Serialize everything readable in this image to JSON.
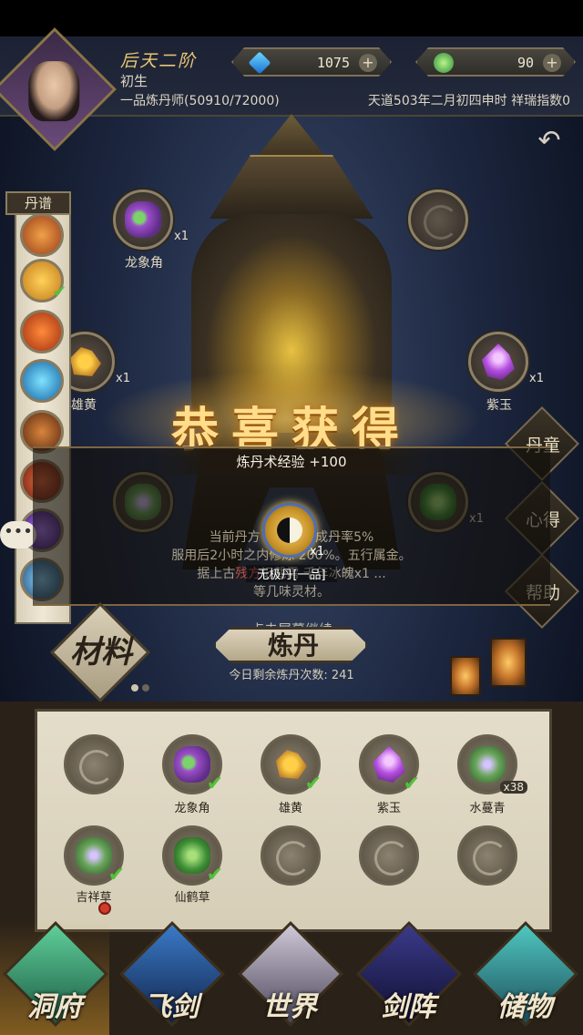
{
  "header": {
    "rank": "后天二阶",
    "stage": "初生",
    "title_line": "一品炼丹师(50910/72000)",
    "currency_1": {
      "icon": "blue-gem-icon",
      "value": "1075"
    },
    "currency_2": {
      "icon": "jade-icon",
      "value": "90"
    },
    "world_time": "天道503年二月初四申时 祥瑞指数0"
  },
  "side_scroll": {
    "title": "丹谱"
  },
  "furnace_slots": [
    {
      "name": "龙象角",
      "count": "x1"
    },
    {
      "name": "",
      "count": ""
    },
    {
      "name": "雄黄",
      "count": "x1"
    },
    {
      "name": "紫玉",
      "count": "x1"
    },
    {
      "name": "吉祥草",
      "count": ""
    },
    {
      "name": "仙鹤草",
      "count": "x1"
    }
  ],
  "right_buttons": [
    "丹童",
    "心得",
    "帮助"
  ],
  "reward": {
    "title": "恭喜获得",
    "exp_line": "炼丹术经验 +100",
    "pill_count": "x1",
    "pill_name": "无极丹[一品]",
    "desc_1": "当前丹方（ ）基础成丹率5%",
    "desc_2": "服用后2小时之内修炼 200%。五行属金。",
    "desc_3_a": "据上古",
    "desc_3_red": "残方",
    "desc_3_b": "记载需 千年冰魄x1 ...",
    "desc_4": "等几味灵材。",
    "continue": "点击屏幕继续"
  },
  "tabs": {
    "materials": "材料",
    "alchemy": "炼丹"
  },
  "remaining": "今日剩余炼丹次数: 241",
  "materials": [
    {
      "name": "",
      "count": "",
      "checked": false
    },
    {
      "name": "龙象角",
      "count": "",
      "checked": true
    },
    {
      "name": "雄黄",
      "count": "",
      "checked": true
    },
    {
      "name": "紫玉",
      "count": "",
      "checked": true
    },
    {
      "name": "水蔓青",
      "count": "x38",
      "checked": false
    },
    {
      "name": "吉祥草",
      "count": "",
      "checked": true
    },
    {
      "name": "仙鹤草",
      "count": "",
      "checked": true
    },
    {
      "name": "",
      "count": "",
      "checked": false
    },
    {
      "name": "",
      "count": "",
      "checked": false
    },
    {
      "name": "",
      "count": "",
      "checked": false
    }
  ],
  "nav": [
    "洞府",
    "飞剑",
    "世界",
    "剑阵",
    "储物"
  ]
}
